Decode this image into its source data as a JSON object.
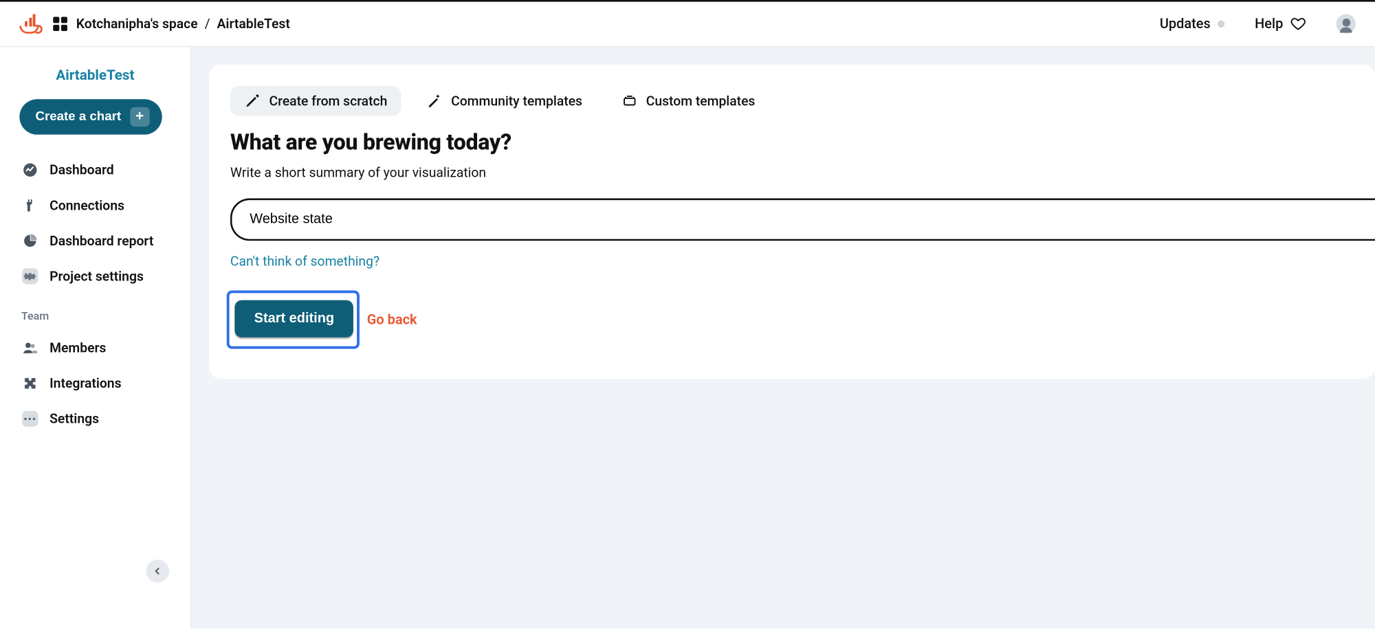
{
  "header": {
    "breadcrumb_space": "Kotchanipha's space",
    "breadcrumb_project": "AirtableTest",
    "updates_label": "Updates",
    "help_label": "Help"
  },
  "sidebar": {
    "project_name": "AirtableTest",
    "create_chart_label": "Create a chart",
    "items": [
      {
        "label": "Dashboard"
      },
      {
        "label": "Connections"
      },
      {
        "label": "Dashboard report"
      },
      {
        "label": "Project settings"
      }
    ],
    "team_heading": "Team",
    "team_items": [
      {
        "label": "Members"
      },
      {
        "label": "Integrations"
      },
      {
        "label": "Settings"
      }
    ]
  },
  "main": {
    "tabs": [
      {
        "label": "Create from scratch"
      },
      {
        "label": "Community templates"
      },
      {
        "label": "Custom templates"
      }
    ],
    "heading": "What are you brewing today?",
    "subheading": "Write a short summary of your visualization",
    "input_value": "Website state",
    "help_link": "Can't think of something?",
    "primary_button": "Start editing",
    "back_link": "Go back"
  }
}
